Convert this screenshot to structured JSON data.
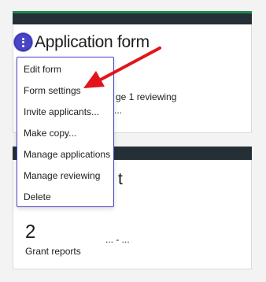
{
  "cards": [
    {
      "title": "Application form",
      "partial_line_1": "ge 1 reviewing",
      "partial_line_2": "..."
    },
    {
      "title_partial": "t",
      "stat_value": "2",
      "stat_label": "Grant reports",
      "ellipsis": "... - ..."
    }
  ],
  "menu": {
    "items": [
      {
        "label": "Edit form"
      },
      {
        "label": "Form settings"
      },
      {
        "label": "Invite applicants..."
      },
      {
        "label": "Make copy..."
      },
      {
        "label": "Manage applications"
      },
      {
        "label": "Manage reviewing"
      },
      {
        "label": "Delete"
      }
    ]
  },
  "annotation": {
    "arrow_color": "#e3141b",
    "points_to": "Form settings"
  },
  "colors": {
    "card_header": "#243036",
    "accent_green": "#1d8a4f",
    "menu_border": "#4a45c6",
    "kebab_button": "#4a45c6"
  }
}
